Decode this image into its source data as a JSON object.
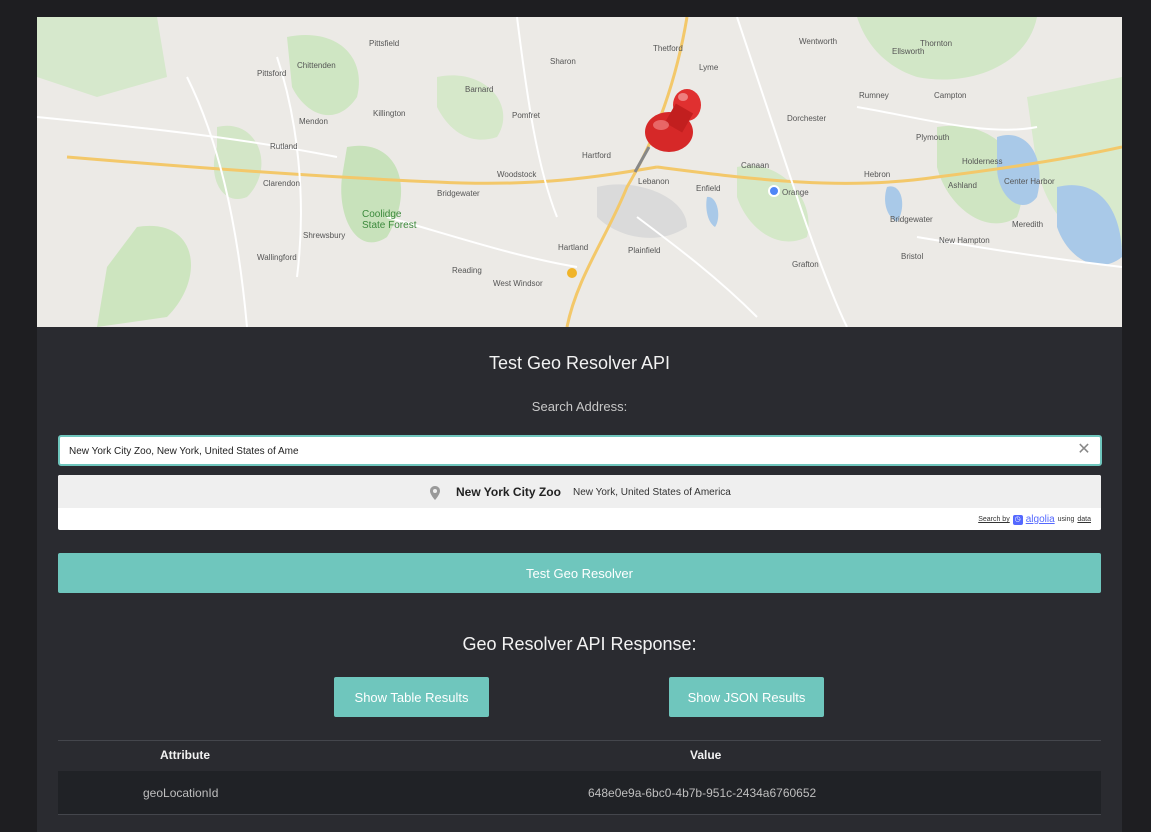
{
  "map": {
    "labels": [
      "Pittsfield",
      "Pittsford",
      "Chittenden",
      "Mendon",
      "Killington",
      "Rutland",
      "Clarendon",
      "Shrewsbury",
      "Wallingford",
      "Coolidge State Forest",
      "Bridgewater",
      "Woodstock",
      "Barnard",
      "Pomfret",
      "Hartford",
      "Sharon",
      "Thetford",
      "Lyme",
      "Lebanon",
      "Hartland",
      "Plainfield",
      "Canaan",
      "Enfield",
      "Orange",
      "Dorchester",
      "Rumney",
      "Campton",
      "Plymouth",
      "Holderness",
      "Ashland",
      "Hebron",
      "Bridgewater",
      "New Hampton",
      "Bristol",
      "Wentworth",
      "Ellsworth",
      "Thornton",
      "Grafton",
      "Center Harbor",
      "Reading",
      "West Windsor",
      "Meredith"
    ]
  },
  "title": "Test Geo Resolver API",
  "search": {
    "label": "Search Address:",
    "value": "New York City Zoo, New York, United States of Ame"
  },
  "suggestion": {
    "name": "New York City Zoo",
    "address": "New York, United States of America",
    "credit_prefix": "Search by",
    "credit_brand": "algolia",
    "credit_suffix": "using",
    "credit_data": "data"
  },
  "test_button": "Test Geo Resolver",
  "response_heading": "Geo Resolver API Response:",
  "show_table_button": "Show Table Results",
  "show_json_button": "Show JSON Results",
  "table": {
    "headers": [
      "Attribute",
      "Value"
    ],
    "rows": [
      {
        "attribute": "geoLocationId",
        "value": "648e0e9a-6bc0-4b7b-951c-2434a6760652"
      }
    ]
  },
  "colors": {
    "accent": "#6fc6bd",
    "background": "#2a2b30",
    "page": "#1e1e21"
  }
}
